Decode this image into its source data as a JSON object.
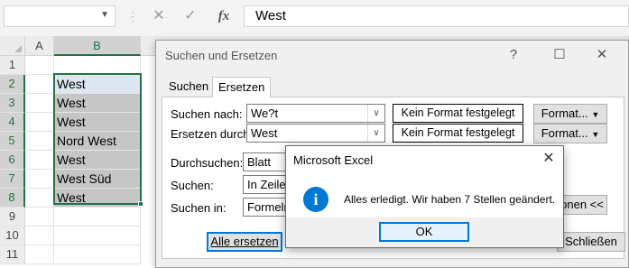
{
  "formula_bar": {
    "name_box_value": "",
    "cancel_symbol": "✕",
    "enter_symbol": "✓",
    "fx_label": "fx",
    "formula_value": "West"
  },
  "sheet": {
    "columns": [
      "A",
      "B"
    ],
    "rows": [
      "1",
      "2",
      "3",
      "4",
      "5",
      "6",
      "7",
      "8",
      "9",
      "10",
      "11"
    ],
    "cells_b": [
      "",
      "West",
      "West",
      "West",
      "Nord West",
      "West",
      "West Süd",
      "West",
      "",
      "",
      ""
    ]
  },
  "find_replace": {
    "title": "Suchen und Ersetzen",
    "tabs": [
      "Suchen",
      "Ersetzen"
    ],
    "find_label": "Suchen nach:",
    "find_value": "We?t",
    "replace_label": "Ersetzen durch:",
    "replace_value": "West",
    "no_format": "Kein Format festgelegt",
    "format_btn": "Format...",
    "within_label": "Durchsuchen:",
    "within_value": "Blatt",
    "search_label": "Suchen:",
    "search_value": "In Zeilen",
    "lookin_label": "Suchen in:",
    "lookin_value": "Formeln",
    "options_btn": "onen <<",
    "replace_all_btn": "Alle ersetzen",
    "close_btn": "Schließen"
  },
  "message_box": {
    "title": "Microsoft Excel",
    "icon": "i",
    "text": "Alles erledigt. Wir haben 7 Stellen geändert.",
    "ok_label": "OK"
  },
  "colors": {
    "accent": "#217346",
    "dialog_blue": "#0078d7"
  }
}
